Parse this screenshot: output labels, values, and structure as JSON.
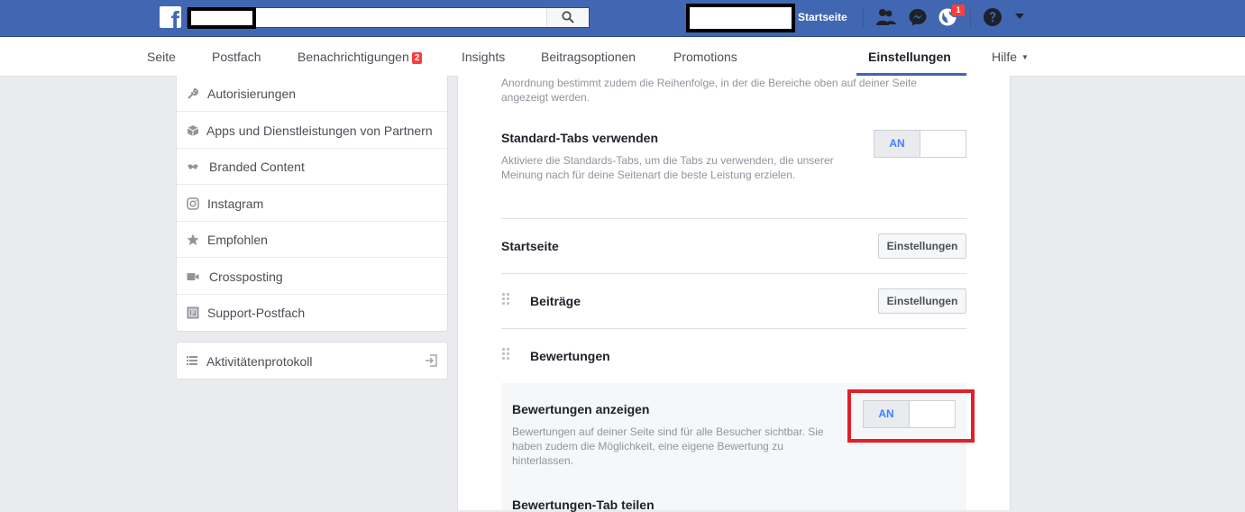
{
  "topbar": {
    "search_placeholder": "",
    "home_label": "Startseite",
    "notification_count": "1",
    "logo_letter": "f"
  },
  "subnav": {
    "items": [
      {
        "label": "Seite"
      },
      {
        "label": "Postfach"
      },
      {
        "label": "Benachrichtigungen",
        "badge": "2"
      },
      {
        "label": "Insights"
      },
      {
        "label": "Beitragsoptionen"
      },
      {
        "label": "Promotions"
      },
      {
        "label": "Einstellungen"
      },
      {
        "label": "Hilfe",
        "caret": "▼"
      }
    ]
  },
  "sidebar": {
    "items": [
      {
        "label": "Autorisierungen",
        "icon": "wrench-icon"
      },
      {
        "label": "Apps und Dienstleistungen von Partnern",
        "icon": "box-icon"
      },
      {
        "label": "Branded Content",
        "icon": "handshake-icon"
      },
      {
        "label": "Instagram",
        "icon": "instagram-icon"
      },
      {
        "label": "Empfohlen",
        "icon": "star-icon"
      },
      {
        "label": "Crossposting",
        "icon": "video-camera-icon"
      },
      {
        "label": "Support-Postfach",
        "icon": "support-inbox-icon"
      }
    ],
    "activity": {
      "label": "Aktivitätenprotokoll",
      "icon": "list-icon"
    }
  },
  "main": {
    "top_text_line1": "Anordnung bestimmt zudem die Reihenfolge, in der die Bereiche oben auf deiner Seite",
    "top_text_line2": "angezeigt werden.",
    "standard_tabs": {
      "title": "Standard-Tabs verwenden",
      "desc_line1": "Aktiviere die Standards-Tabs, um die Tabs zu verwenden, die unserer",
      "desc_line2": "Meinung nach für deine Seitenart die beste Leistung erzielen.",
      "toggle_label": "AN"
    },
    "sections": [
      {
        "title": "Startseite",
        "button": "Einstellungen"
      },
      {
        "title": "Beiträge",
        "button": "Einstellungen"
      },
      {
        "title": "Bewertungen"
      }
    ],
    "reviews": {
      "title": "Bewertungen anzeigen",
      "desc_line1": "Bewertungen auf deiner Seite sind für alle Besucher sichtbar. Sie",
      "desc_line2": "haben zudem die Möglichkeit, eine eigene Bewertung zu",
      "desc_line3": "hinterlassen.",
      "toggle_label": "AN",
      "share_title": "Bewertungen-Tab teilen"
    }
  },
  "colors": {
    "brand_blue": "#4267b2",
    "highlight_red": "#e0202a",
    "toggle_on_text": "#4080ff"
  }
}
